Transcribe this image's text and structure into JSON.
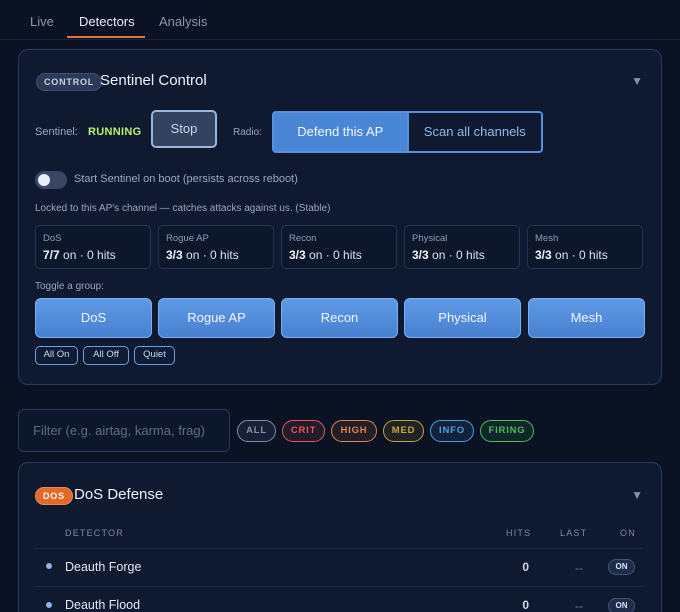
{
  "tabs": [
    {
      "label": "Live"
    },
    {
      "label": "Detectors"
    },
    {
      "label": "Analysis"
    }
  ],
  "control": {
    "badge": "CONTROL",
    "title": "Sentinel Control",
    "caret": "▼",
    "sentinel_label": "Sentinel:",
    "status": "RUNNING",
    "stop_label": "Stop",
    "radio_label": "Radio:",
    "radio_options": [
      "Defend this AP",
      "Scan all channels"
    ],
    "radio_selected": "Defend this AP",
    "boot_toggle_label": "Start Sentinel on boot (persists across reboot)",
    "boot_toggle_on": false,
    "info_text": "Locked to this AP's channel — catches attacks against us. (Stable)",
    "stats": [
      {
        "name": "DoS",
        "count": "7/7",
        "rest": " on · 0 hits"
      },
      {
        "name": "Rogue AP",
        "count": "3/3",
        "rest": " on · 0 hits"
      },
      {
        "name": "Recon",
        "count": "3/3",
        "rest": " on · 0 hits"
      },
      {
        "name": "Physical",
        "count": "3/3",
        "rest": " on · 0 hits"
      },
      {
        "name": "Mesh",
        "count": "3/3",
        "rest": " on · 0 hits"
      }
    ],
    "toggle_group_label": "Toggle a group:",
    "groups": [
      "DoS",
      "Rogue AP",
      "Recon",
      "Physical",
      "Mesh"
    ],
    "mini_buttons": [
      "All On",
      "All Off",
      "Quiet"
    ]
  },
  "filter": {
    "placeholder": "Filter (e.g. airtag, karma, frag)",
    "value": ""
  },
  "chips": [
    {
      "label": "ALL",
      "color": "#7f8fae"
    },
    {
      "label": "CRIT",
      "color": "#e05a5a"
    },
    {
      "label": "HIGH",
      "color": "#e0834a"
    },
    {
      "label": "MED",
      "color": "#c9a23a"
    },
    {
      "label": "INFO",
      "color": "#4aa0e0"
    },
    {
      "label": "FIRING",
      "color": "#4bbf5a"
    }
  ],
  "dos": {
    "badge": "DOS",
    "title": "DoS Defense",
    "caret": "▼",
    "columns": {
      "detector": "DETECTOR",
      "hits": "HITS",
      "last": "LAST",
      "on": "ON"
    },
    "rows": [
      {
        "name": "Deauth Forge",
        "hits": "0",
        "last": "--",
        "on": "ON"
      },
      {
        "name": "Deauth Flood",
        "hits": "0",
        "last": "--",
        "on": "ON"
      }
    ]
  },
  "colors": {
    "accent": "#4a86d6",
    "running": "#b9f070",
    "dos_badge": "#e06a2c",
    "tab_underline": "#e07a3a"
  }
}
